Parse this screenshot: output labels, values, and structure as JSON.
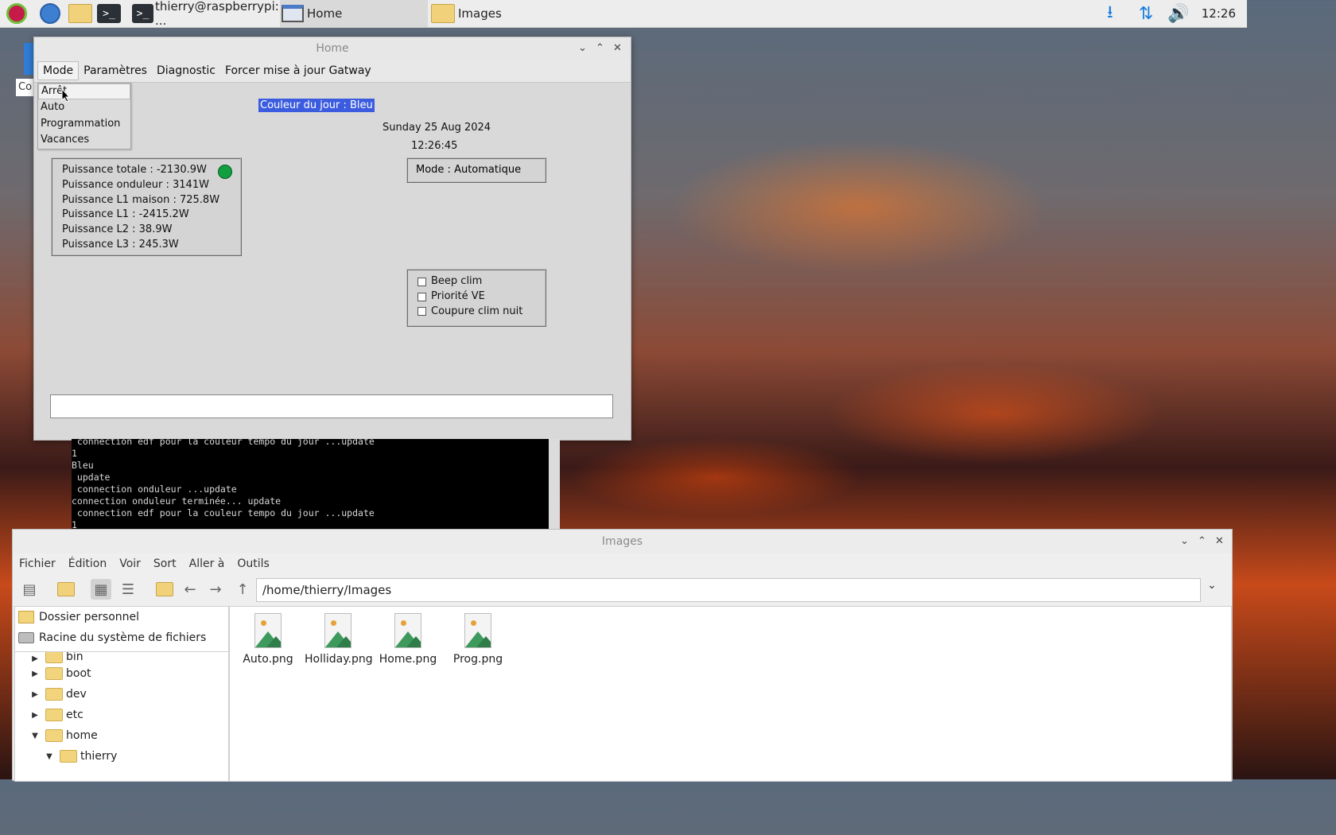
{
  "taskbar": {
    "tasks": [
      {
        "label": "thierry@raspberrypi: ..."
      },
      {
        "label": "Home"
      },
      {
        "label": "Images"
      }
    ],
    "clock": "12:26"
  },
  "home_window": {
    "title": "Home",
    "menu": [
      "Mode",
      "Paramètres",
      "Diagnostic",
      "Forcer mise à jour Gatway"
    ],
    "dropdown": [
      "Arrêt",
      "Auto",
      "Programmation",
      "Vacances"
    ],
    "couleur": "Couleur du jour : Bleu",
    "date": "Sunday 25 Aug 2024",
    "time": "12:26:45",
    "mode": "Mode  : Automatique",
    "power": [
      "Puissance totale : -2130.9W",
      "Puissance onduleur : 3141W",
      "Puissance L1 maison : 725.8W",
      "Puissance L1 : -2415.2W",
      "Puissance L2 : 38.9W",
      "Puissance L3 : 245.3W"
    ],
    "status_led_color": "#10a040",
    "options": [
      "Beep clim",
      "Priorité VE",
      "Coupure clim nuit"
    ]
  },
  "terminal": {
    "lines": [
      " connection edf pour la couleur tempo du jour ...update",
      "1",
      "Bleu",
      " update",
      " connection onduleur ...update",
      "connection onduleur terminée... update",
      " connection edf pour la couleur tempo du jour ...update",
      "1"
    ]
  },
  "desktop": {
    "trash_label": "Co"
  },
  "images_window": {
    "title": "Images",
    "menu": [
      "Fichier",
      "Édition",
      "Voir",
      "Sort",
      "Aller à",
      "Outils"
    ],
    "path": "/home/thierry/Images",
    "places": [
      "Dossier personnel",
      "Racine du système de fichiers"
    ],
    "tree": [
      "bin",
      "boot",
      "dev",
      "etc",
      "home",
      "thierry"
    ],
    "files": [
      "Auto.png",
      "Holliday.png",
      "Home.png",
      "Prog.png"
    ]
  }
}
